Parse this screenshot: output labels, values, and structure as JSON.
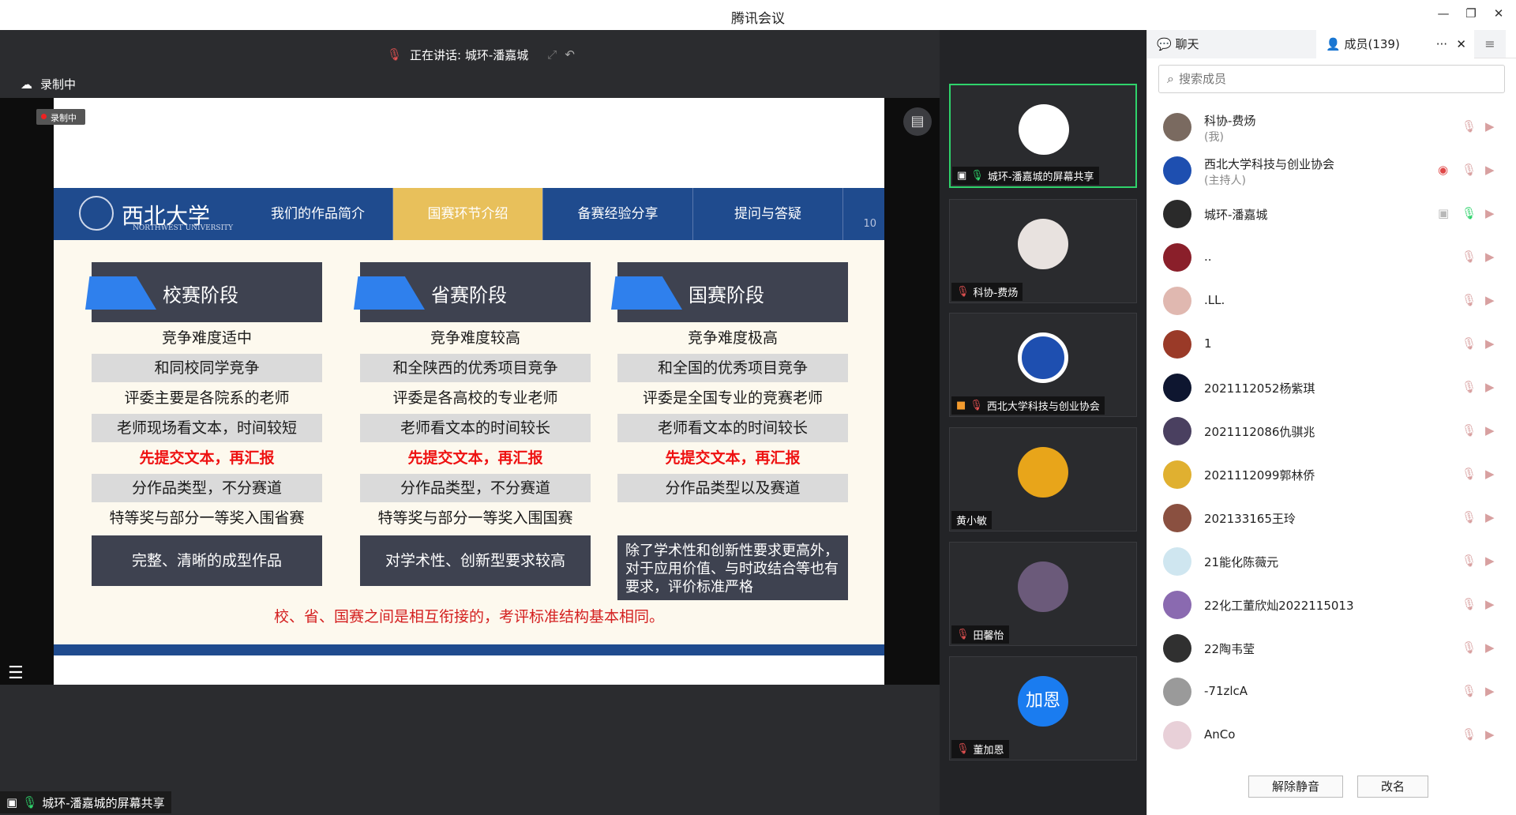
{
  "window": {
    "title": "腾讯会议",
    "minimize": "—",
    "restore": "❐",
    "close": "✕"
  },
  "stage": {
    "speaking": "正在讲话: 城环-潘嘉城",
    "recording": "录制中",
    "mini_recording": "录制中",
    "share_label": "城环-潘嘉城的屏幕共享"
  },
  "slide": {
    "logo_text": "西北大学",
    "logo_sub": "NORTHWEST UNIVERSITY",
    "tabs": [
      "我们的作品简介",
      "国赛环节介绍",
      "备赛经验分享",
      "提问与答疑"
    ],
    "page_num": "10",
    "columns": [
      {
        "header": "校赛阶段",
        "rows": [
          "竞争难度适中",
          "和同校同学竞争",
          "评委主要是各院系的老师",
          "老师现场看文本，时间较短",
          "先提交文本，再汇报",
          "分作品类型，不分赛道",
          "特等奖与部分一等奖入围省赛"
        ],
        "footer": "完整、清晰的成型作品"
      },
      {
        "header": "省赛阶段",
        "rows": [
          "竞争难度较高",
          "和全陕西的优秀项目竞争",
          "评委是各高校的专业老师",
          "老师看文本的时间较长",
          "先提交文本，再汇报",
          "分作品类型，不分赛道",
          "特等奖与部分一等奖入围国赛"
        ],
        "footer": "对学术性、创新型要求较高"
      },
      {
        "header": "国赛阶段",
        "rows": [
          "竞争难度极高",
          "和全国的优秀项目竞争",
          "评委是全国专业的竞赛老师",
          "老师看文本的时间较长",
          "先提交文本，再汇报",
          "分作品类型以及赛道"
        ],
        "footer": "除了学术性和创新性要求更高外，对于应用价值、与时政结合等也有要求，评价标准严格"
      }
    ],
    "summary": "校、省、国赛之间是相互衔接的，考评标准结构基本相同。"
  },
  "video_tiles": [
    {
      "name": "城环-潘嘉城的屏幕共享",
      "color": "#ffffff"
    },
    {
      "name": "科协-费炀",
      "color": "#e8e2df"
    },
    {
      "name": "西北大学科技与创业协会",
      "color": "#1e4fb0"
    },
    {
      "name": "黄小敏",
      "color": "#e8a51a"
    },
    {
      "name": "田馨怡",
      "color": "#6b5a7a"
    },
    {
      "name": "董加恩",
      "color": "#1a7cf0",
      "initials": "加恩"
    }
  ],
  "panel": {
    "tab_chat": "聊天",
    "tab_members": "成员(139)",
    "more": "···",
    "close": "✕",
    "menu": "≡",
    "search_placeholder": "搜索成员",
    "members": [
      {
        "name": "科协-费炀",
        "sub": "(我)",
        "color": "#7a6a60"
      },
      {
        "name": "西北大学科技与创业协会",
        "sub": "(主持人)",
        "color": "#1e4fb0"
      },
      {
        "name": "城环-潘嘉城",
        "color": "#2a2a2a"
      },
      {
        "name": "..",
        "color": "#8a1f2a"
      },
      {
        "name": ".LL.",
        "color": "#e0b8b0"
      },
      {
        "name": "1",
        "color": "#9a3a28"
      },
      {
        "name": "2021112052杨紫琪",
        "color": "#0e1630"
      },
      {
        "name": "2021112086仇骐兆",
        "color": "#4a4060"
      },
      {
        "name": "2021112099郭林侨",
        "color": "#e0b030"
      },
      {
        "name": "202133165王玲",
        "color": "#8a5040"
      },
      {
        "name": "21能化陈薇元",
        "color": "#cfe6f0"
      },
      {
        "name": "22化工董欣灿2022115013",
        "color": "#8a6ab0"
      },
      {
        "name": "22陶韦莹",
        "color": "#303030"
      },
      {
        "name": "-71zlcA",
        "color": "#9a9a9a"
      },
      {
        "name": "AnCo",
        "color": "#e8d0d8"
      }
    ],
    "btn_unmute": "解除静音",
    "btn_rename": "改名"
  }
}
